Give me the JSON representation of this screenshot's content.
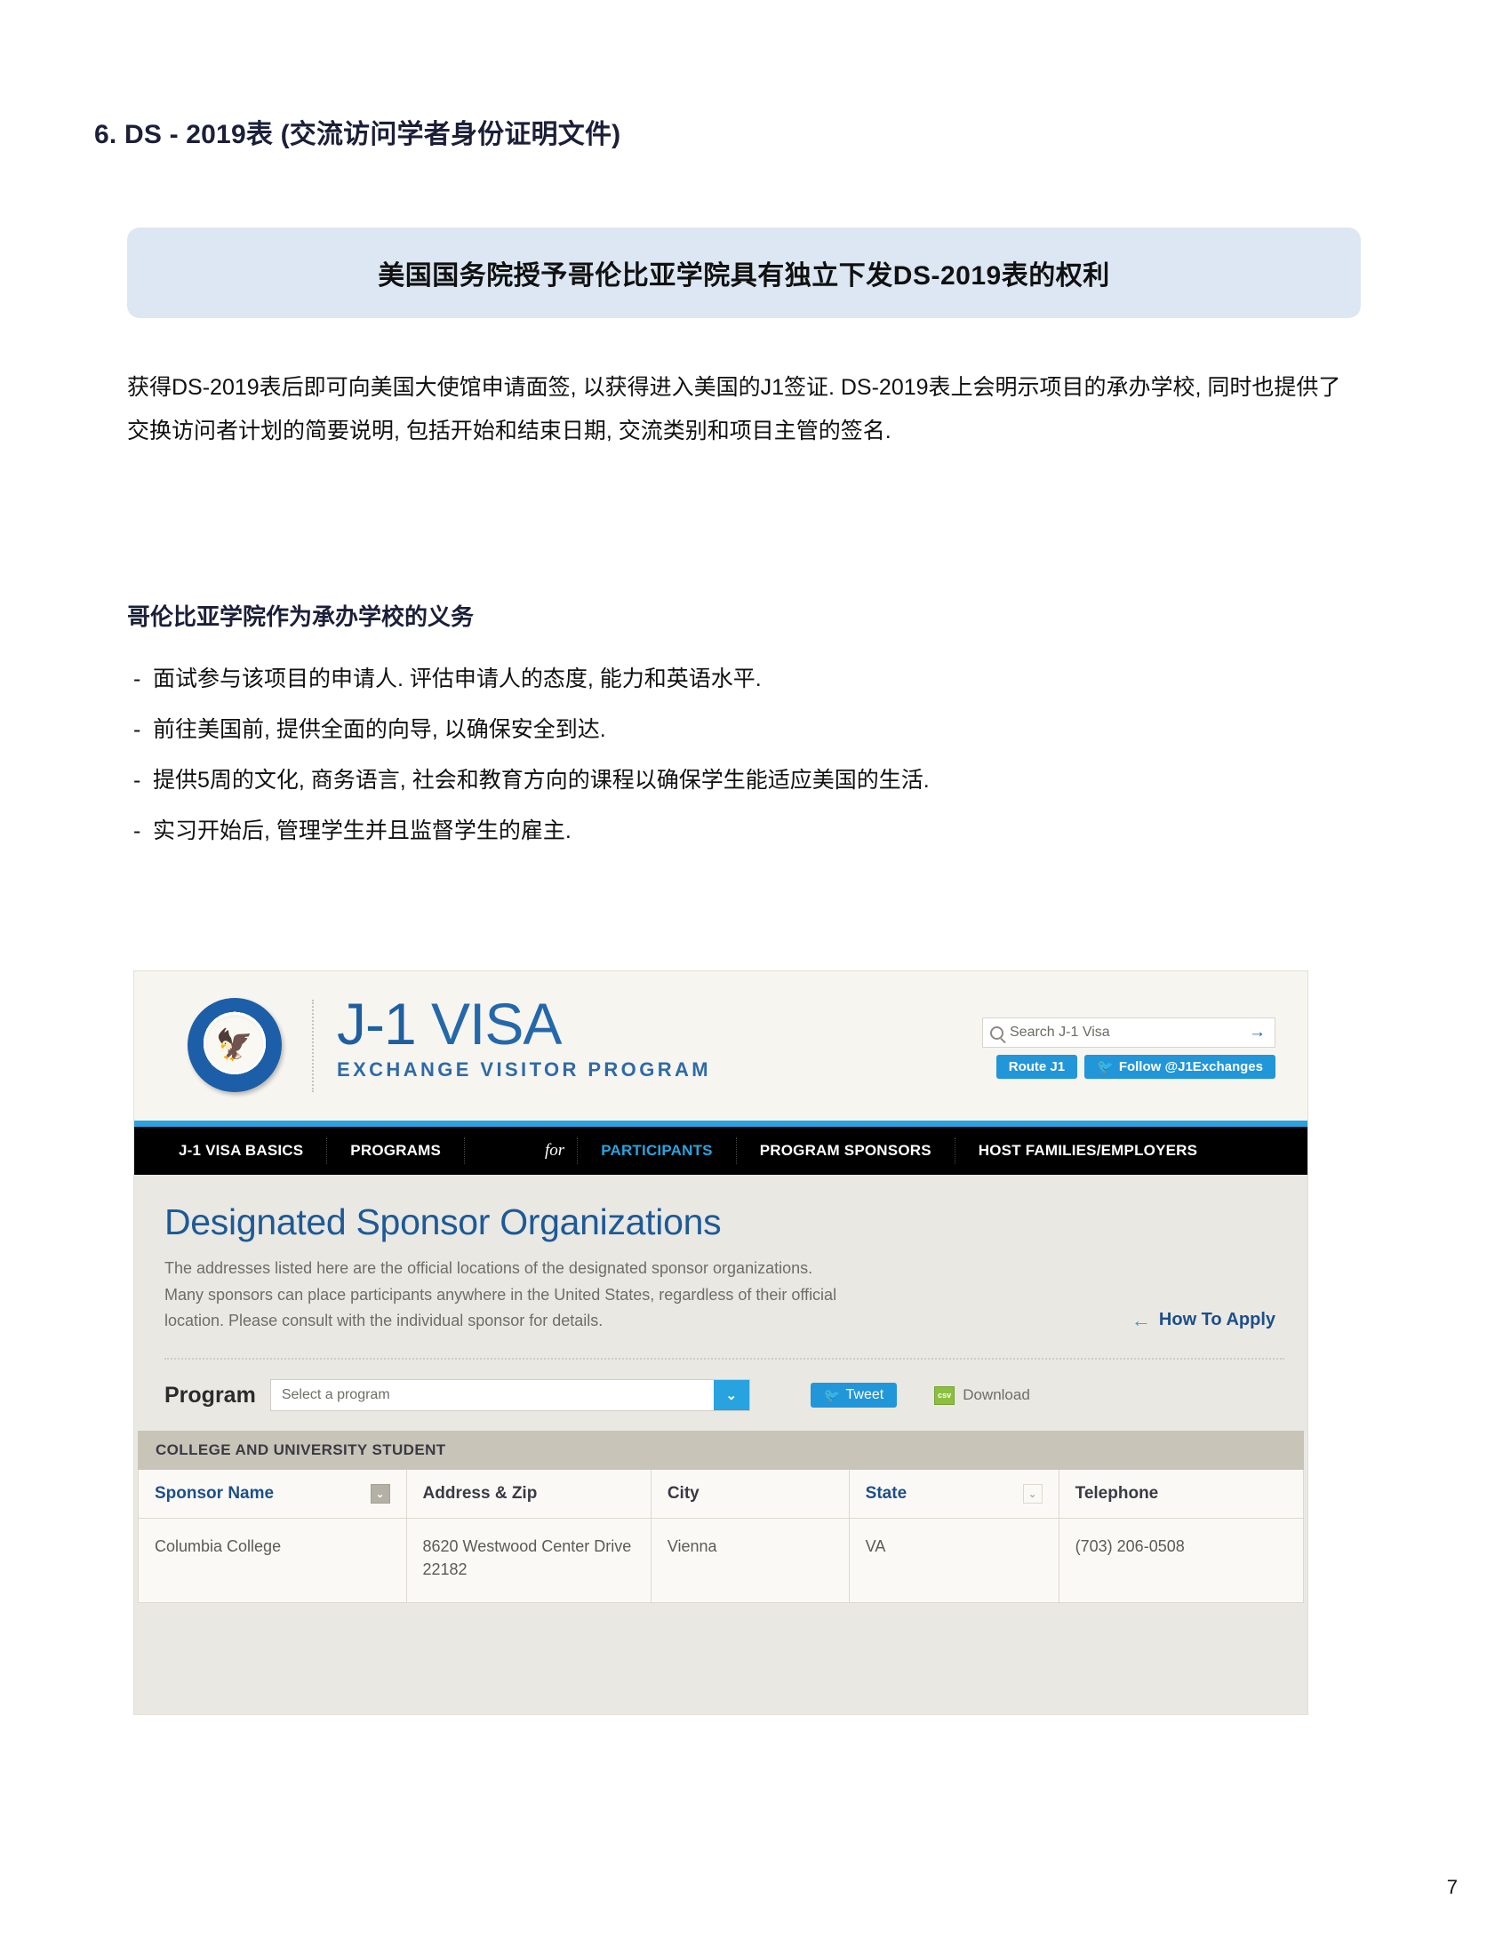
{
  "document": {
    "title": "6. DS - 2019表 (交流访问学者身份证明文件)",
    "banner_text": "美国国务院授予哥伦比亚学院具有独立下发DS-2019表的权利",
    "paragraph": "获得DS-2019表后即可向美国大使馆申请面签, 以获得进入美国的J1签证. DS-2019表上会明示项目的承办学校, 同时也提供了交换访问者计划的简要说明, 包括开始和结束日期, 交流类别和项目主管的签名.",
    "section_heading": "哥伦比亚学院作为承办学校的义务",
    "bullet_dash": "-",
    "bullets": [
      "面试参与该项目的申请人. 评估申请人的态度, 能力和英语水平.",
      "前往美国前, 提供全面的向导, 以确保安全到达.",
      "提供5周的文化, 商务语言, 社会和教育方向的课程以确保学生能适应美国的生活.",
      "实习开始后, 管理学生并且监督学生的雇主."
    ],
    "page_number": "7",
    "banner_color": "#dde7f3",
    "heading_color": "#1b1f38"
  },
  "screenshot": {
    "header": {
      "seal_glyph": "🦅",
      "brand_j1": "J-1",
      "brand_visa": "VISA",
      "brand_sub": "EXCHANGE VISITOR PROGRAM",
      "search_placeholder": "Search J-1 Visa",
      "search_value": "",
      "search_submit": "→",
      "route_button": "Route J1",
      "twitter_glyph": "🐦",
      "follow_button": "Follow @J1Exchanges"
    },
    "nav": {
      "items": [
        {
          "label": "J-1 VISA BASICS",
          "active": false
        },
        {
          "label": "PROGRAMS",
          "active": false
        }
      ],
      "for_label": "for",
      "items2": [
        {
          "label": "PARTICIPANTS",
          "active": true
        },
        {
          "label": "PROGRAM SPONSORS",
          "active": false
        },
        {
          "label": "HOST FAMILIES/EMPLOYERS",
          "active": false
        }
      ],
      "active_color": "#29a3e0",
      "bar_color": "#000000",
      "rule_color": "#29a3e0"
    },
    "content": {
      "page_heading": "Designated Sponsor Organizations",
      "description_line1": "The addresses listed here are the official locations of the designated sponsor organizations.",
      "description_line2": "Many sponsors can place participants anywhere in the United States, regardless of their official",
      "description_line3": "location. Please consult with the individual sponsor for details.",
      "how_to_apply_arrow": "←",
      "how_to_apply": "How To Apply",
      "program_label": "Program",
      "program_placeholder": "Select a program",
      "program_caret": "⌄",
      "tweet_glyph": "🐦",
      "tweet_label": "Tweet",
      "csv_badge": "csv",
      "download_label": "Download",
      "heading_color": "#1d5a96"
    },
    "table": {
      "section_title": "COLLEGE AND UNIVERSITY STUDENT",
      "columns": [
        {
          "label": "Sponsor Name",
          "style": "blue",
          "dropdown": "filled"
        },
        {
          "label": "Address & Zip",
          "style": "dark",
          "dropdown": "none"
        },
        {
          "label": "City",
          "style": "dark",
          "dropdown": "none"
        },
        {
          "label": "State",
          "style": "blue",
          "dropdown": "light"
        },
        {
          "label": "Telephone",
          "style": "dark",
          "dropdown": "none"
        }
      ],
      "dropdown_caret": "⌄",
      "rows": [
        {
          "sponsor_name": "Columbia College",
          "address": "8620 Westwood Center Drive",
          "zip": "22182",
          "city": "Vienna",
          "state": "VA",
          "telephone": "(703) 206-0508"
        }
      ]
    }
  }
}
